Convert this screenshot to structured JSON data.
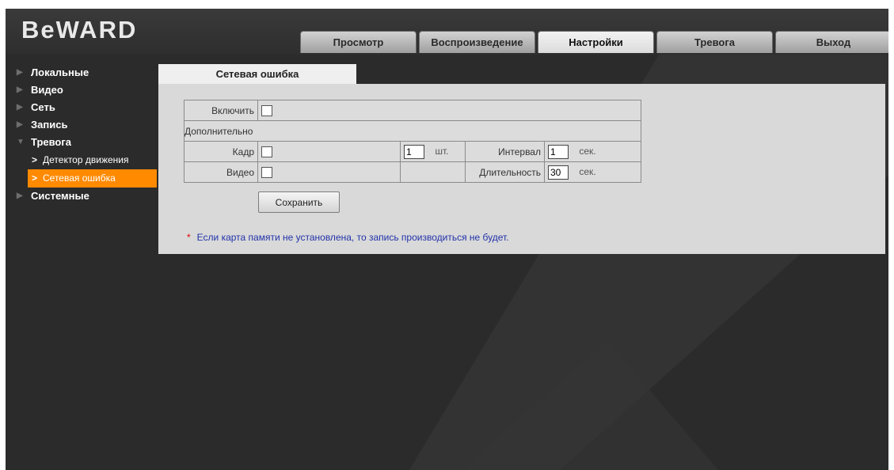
{
  "header": {
    "logo": "BeWARD",
    "tabs": [
      {
        "label": "Просмотр"
      },
      {
        "label": "Воспроизведение"
      },
      {
        "label": "Настройки"
      },
      {
        "label": "Тревога"
      },
      {
        "label": "Выход"
      }
    ],
    "active_tab": "Настройки"
  },
  "sidebar": {
    "items": [
      {
        "label": "Локальные"
      },
      {
        "label": "Видео"
      },
      {
        "label": "Сеть"
      },
      {
        "label": "Запись"
      },
      {
        "label": "Тревога",
        "expanded": true
      },
      {
        "label": "Системные"
      }
    ],
    "subitems": [
      {
        "label": "Детектор движения"
      },
      {
        "label": "Сетевая ошибка",
        "active": true
      }
    ]
  },
  "content": {
    "tab_title": "Сетевая ошибка",
    "enable_label": "Включить",
    "enable_checked": false,
    "extra_label": "Дополнительно",
    "frame_label": "Кадр",
    "frame_checked": false,
    "frame_count": "1",
    "frame_count_unit": "шт.",
    "interval_label": "Интервал",
    "interval_value": "1",
    "interval_unit": "сек.",
    "video_label": "Видео",
    "video_checked": false,
    "duration_label": "Длительность",
    "duration_value": "30",
    "duration_unit": "сек.",
    "save_label": "Сохранить",
    "note_star": "*",
    "note_text": "Если карта памяти не установлена, то запись производиться не будет."
  },
  "colors": {
    "background": "#2b2b2b",
    "accent": "#ff8a00",
    "panel": "#d9d9d9",
    "note_text": "#2233aa"
  }
}
